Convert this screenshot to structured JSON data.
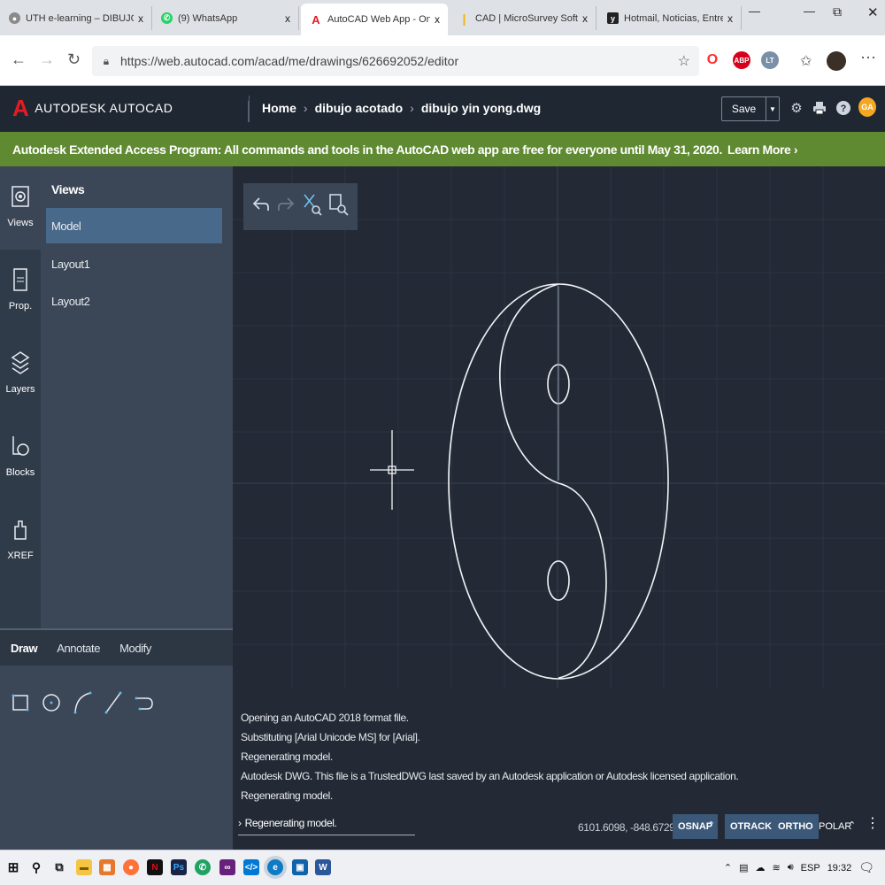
{
  "browser": {
    "tabs": [
      {
        "title": "UTH e-learning – DIBUJO TEC",
        "fav_color": "#8a8a8a",
        "fav_glyph": "●"
      },
      {
        "title": "(9) WhatsApp",
        "fav_color": "#25d366",
        "fav_glyph": "✆"
      },
      {
        "title": "AutoCAD Web App - Online C",
        "fav_color": "#e51b23",
        "fav_glyph": "A"
      },
      {
        "title": "CAD | MicroSurvey Software",
        "fav_color": "#f0b400",
        "fav_glyph": "|"
      },
      {
        "title": "Hotmail, Noticias, Entretenim",
        "fav_color": "#222222",
        "fav_glyph": "y"
      }
    ],
    "close_glyph": "x",
    "new_tab_glyph": "—",
    "url": "https://web.autocad.com/acad/me/drawings/626692052/editor",
    "ext_badges": [
      "O",
      "ABP",
      "LT"
    ]
  },
  "app": {
    "brand": "AUTODESK AUTOCAD",
    "logo_letter": "A",
    "breadcrumb": {
      "home": "Home",
      "folder": "dibujo acotado",
      "file": "dibujo yin yong.dwg"
    },
    "save_label": "Save",
    "user_initials": "GA"
  },
  "banner": {
    "text": "Autodesk Extended Access Program: All commands and tools in the AutoCAD web app are free for everyone until May 31, 2020.",
    "link": "Learn More ›"
  },
  "rail": [
    {
      "label": "Views",
      "icon": "views-icon"
    },
    {
      "label": "Prop.",
      "icon": "properties-icon"
    },
    {
      "label": "Layers",
      "icon": "layers-icon"
    },
    {
      "label": "Blocks",
      "icon": "blocks-icon"
    },
    {
      "label": "XREF",
      "icon": "xref-icon"
    }
  ],
  "views_panel": {
    "title": "Views",
    "items": [
      "Model",
      "Layout1",
      "Layout2"
    ],
    "selected": "Model"
  },
  "draw_panel": {
    "tabs": [
      "Draw",
      "Annotate",
      "Modify"
    ],
    "active_tab": "Draw",
    "tools": [
      "rectangle-icon",
      "circle-icon",
      "arc-icon",
      "line-icon",
      "polyline-icon"
    ]
  },
  "command_log": [
    "Opening an AutoCAD 2018 format file.",
    "Substituting [Arial Unicode MS] for [Arial].",
    "Regenerating model.",
    "Autodesk DWG. This file is a TrustedDWG last saved by an Autodesk application or Autodesk licensed application.",
    "Regenerating model."
  ],
  "command_line": {
    "prompt": "›",
    "text": "Regenerating model."
  },
  "status": {
    "coords": "6101.6098, -848.6729",
    "toggles": [
      {
        "label": "OSNAP",
        "on": true
      },
      {
        "label": "OTRACK",
        "on": true
      },
      {
        "label": "ORTHO",
        "on": true
      },
      {
        "label": "POLAR",
        "on": false
      }
    ]
  },
  "taskbar": {
    "tray_lang": "ESP",
    "tray_time": "19:32"
  }
}
